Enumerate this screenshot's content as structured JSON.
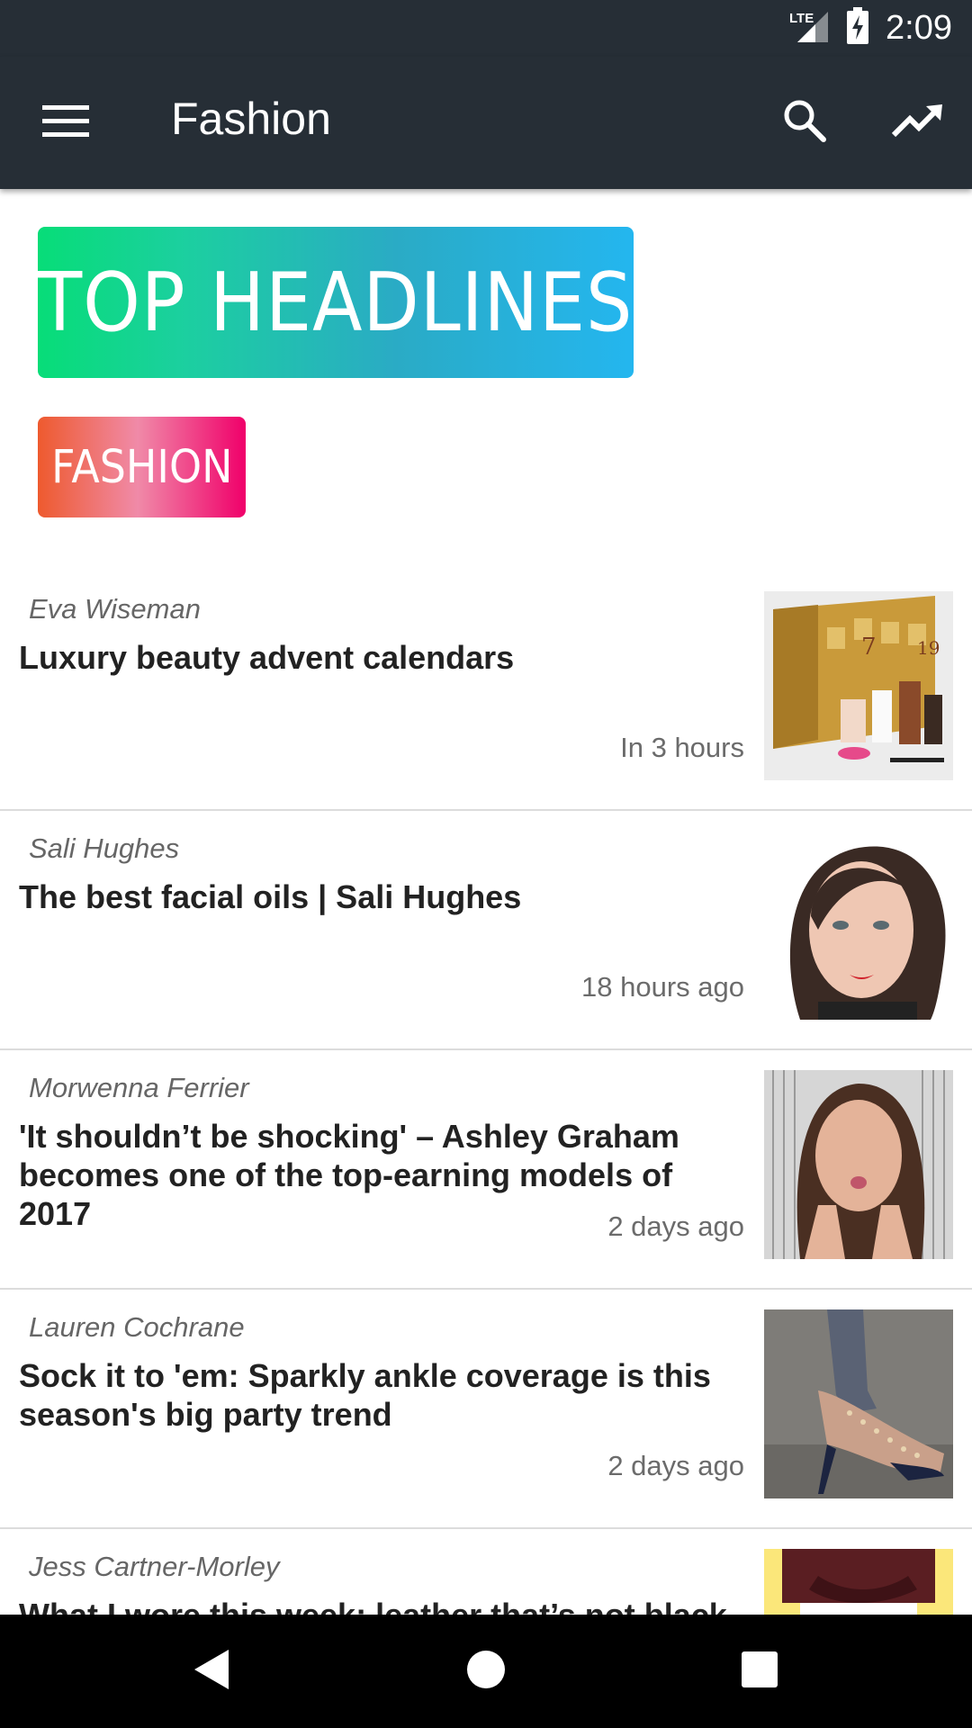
{
  "status_bar": {
    "network": "LTE",
    "time": "2:09"
  },
  "app_bar": {
    "title": "Fashion",
    "icons": [
      "menu-icon",
      "search-icon",
      "trending-up-icon"
    ]
  },
  "banner": {
    "label": "TOP HEADLINES",
    "colors": [
      "#07dd78",
      "#24b6ef"
    ]
  },
  "category_chip": {
    "label": "FASHION",
    "colors": [
      "#ee5a2e",
      "#f0006a"
    ]
  },
  "articles": [
    {
      "byline": "Eva Wiseman",
      "title": "Luxury beauty advent calendars",
      "time": "In 3 hours"
    },
    {
      "byline": "Sali Hughes",
      "title": "The best facial oils | Sali Hughes",
      "time": "18 hours ago"
    },
    {
      "byline": "Morwenna Ferrier",
      "title": "'It shouldn’t be shocking' – Ashley Graham becomes one of the top-earning models of 2017",
      "time": "2 days ago"
    },
    {
      "byline": "Lauren Cochrane",
      "title": "Sock it to 'em: Sparkly ankle coverage is this season's big party trend",
      "time": "2 days ago"
    },
    {
      "byline": "Jess Cartner-Morley",
      "title": "What I wore this week: leather that’s not black",
      "time": ""
    }
  ],
  "nav_bar": {
    "icons": [
      "back-icon",
      "home-icon",
      "recents-icon"
    ]
  },
  "theme": {
    "app_bar_color": "#262e36",
    "nav_bar_color": "#000000"
  }
}
